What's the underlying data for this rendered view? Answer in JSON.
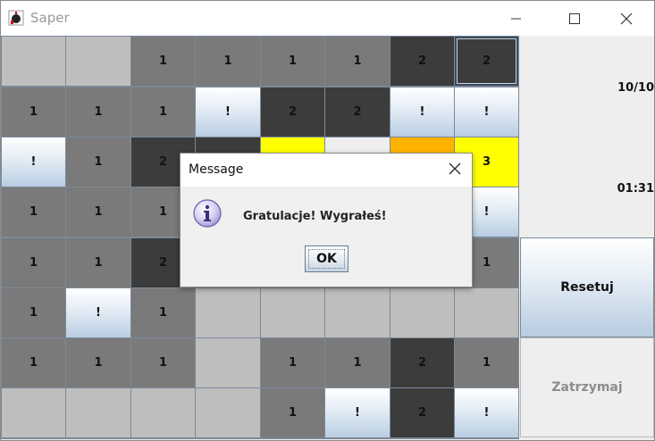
{
  "window": {
    "title": "Saper",
    "controls": {
      "minimize": "minimize",
      "maximize": "maximize",
      "close": "close"
    }
  },
  "board": {
    "rows": [
      [
        {
          "state": "hidden",
          "label": ""
        },
        {
          "state": "hidden",
          "label": ""
        },
        {
          "state": "open",
          "label": "1"
        },
        {
          "state": "open",
          "label": "1"
        },
        {
          "state": "open",
          "label": "1"
        },
        {
          "state": "open",
          "label": "1"
        },
        {
          "state": "dark",
          "label": "2"
        },
        {
          "state": "dark",
          "label": "2",
          "selected": true
        }
      ],
      [
        {
          "state": "open",
          "label": "1"
        },
        {
          "state": "open",
          "label": "1"
        },
        {
          "state": "open",
          "label": "1"
        },
        {
          "state": "flag",
          "label": "!"
        },
        {
          "state": "dark",
          "label": "2"
        },
        {
          "state": "dark",
          "label": "2"
        },
        {
          "state": "flag",
          "label": "!"
        },
        {
          "state": "flag",
          "label": "!"
        }
      ],
      [
        {
          "state": "flag",
          "label": "!"
        },
        {
          "state": "open",
          "label": "1"
        },
        {
          "state": "dark",
          "label": "2"
        },
        {
          "state": "dark",
          "label": ""
        },
        {
          "state": "yellow",
          "label": ""
        },
        {
          "state": "light",
          "label": ""
        },
        {
          "state": "orange",
          "label": ""
        },
        {
          "state": "yellow",
          "label": "3"
        }
      ],
      [
        {
          "state": "open",
          "label": "1"
        },
        {
          "state": "open",
          "label": "1"
        },
        {
          "state": "open",
          "label": "1"
        },
        {
          "state": "open",
          "label": ""
        },
        {
          "state": "open",
          "label": ""
        },
        {
          "state": "open",
          "label": ""
        },
        {
          "state": "open",
          "label": ""
        },
        {
          "state": "flag",
          "label": "!"
        }
      ],
      [
        {
          "state": "open",
          "label": "1"
        },
        {
          "state": "open",
          "label": "1"
        },
        {
          "state": "dark",
          "label": "2"
        },
        {
          "state": "open",
          "label": ""
        },
        {
          "state": "open",
          "label": ""
        },
        {
          "state": "open",
          "label": ""
        },
        {
          "state": "open",
          "label": ""
        },
        {
          "state": "open",
          "label": "1"
        }
      ],
      [
        {
          "state": "open",
          "label": "1"
        },
        {
          "state": "flag",
          "label": "!"
        },
        {
          "state": "open",
          "label": "1"
        },
        {
          "state": "hidden",
          "label": ""
        },
        {
          "state": "hidden",
          "label": ""
        },
        {
          "state": "hidden",
          "label": ""
        },
        {
          "state": "hidden",
          "label": ""
        },
        {
          "state": "hidden",
          "label": ""
        }
      ],
      [
        {
          "state": "open",
          "label": "1"
        },
        {
          "state": "open",
          "label": "1"
        },
        {
          "state": "open",
          "label": "1"
        },
        {
          "state": "hidden",
          "label": ""
        },
        {
          "state": "open",
          "label": "1"
        },
        {
          "state": "open",
          "label": "1"
        },
        {
          "state": "dark",
          "label": "2"
        },
        {
          "state": "open",
          "label": "1"
        }
      ],
      [
        {
          "state": "hidden",
          "label": ""
        },
        {
          "state": "hidden",
          "label": ""
        },
        {
          "state": "hidden",
          "label": ""
        },
        {
          "state": "hidden",
          "label": ""
        },
        {
          "state": "open",
          "label": "1"
        },
        {
          "state": "flag",
          "label": "!"
        },
        {
          "state": "dark",
          "label": "2"
        },
        {
          "state": "flag",
          "label": "!"
        }
      ]
    ]
  },
  "sidebar": {
    "mine_counter": "10/10",
    "timer": "01:31",
    "reset_label": "Resetuj",
    "stop_label": "Zatrzymaj"
  },
  "dialog": {
    "title": "Message",
    "message": "Gratulacje! Wygrałeś!",
    "ok_label": "OK",
    "icon": "info-icon"
  },
  "colors": {
    "open": "#7a7a7a",
    "dark": "#3c3c3c",
    "hidden": "#bebebe",
    "yellow": "#ffff00",
    "orange": "#ffb300"
  }
}
